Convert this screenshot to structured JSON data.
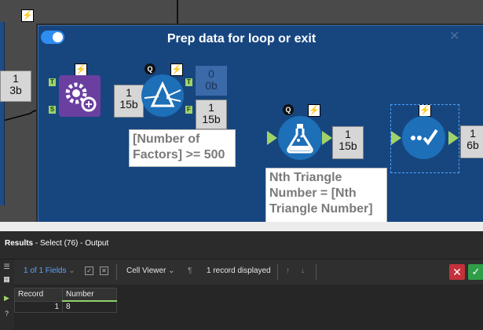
{
  "canvas": {
    "container_title": "Prep data for loop or exit",
    "colors": {
      "container_bg": "#17467f",
      "anchor": "#9fd36a",
      "toggle": "#2e8df0",
      "formula_tool": "#1d6fb8",
      "multi_row_tool": "#6b3fa0"
    },
    "badges": {
      "bolt": "⚡",
      "query": "Q"
    },
    "counts": {
      "left_in": {
        "records": "1",
        "size": "3b"
      },
      "multi_out": {
        "records": "1",
        "size": "15b"
      },
      "filter_true": {
        "records": "0",
        "size": "0b"
      },
      "filter_false": {
        "records": "1",
        "size": "15b"
      },
      "formula_out": {
        "records": "1",
        "size": "15b"
      },
      "select_out": {
        "records": "1",
        "size": "6b"
      }
    },
    "anchors": {
      "target": "T",
      "source": "S",
      "true": "T",
      "false": "F"
    },
    "annotations": {
      "filter": "[Number of Factors] >= 500",
      "formula": "Nth Triangle Number = [Nth Triangle Number]"
    },
    "icons": {
      "multi_row": "gears-plus-icon",
      "filter": "prism-filter-icon",
      "formula": "flask-icon",
      "select": "checkmark-select-icon"
    }
  },
  "results": {
    "title_bold": "Results",
    "title_rest": " - Select (76) - Output",
    "toolbar": {
      "fields": "1 of 1 Fields",
      "viewer": "Cell Viewer",
      "record_count": "1 record displayed"
    },
    "grid": {
      "columns": [
        "Record",
        "Number"
      ],
      "rows": [
        {
          "record": "1",
          "number": "8"
        }
      ]
    },
    "colors": {
      "cancel": "#c3323a",
      "apply": "#2f9e48"
    }
  }
}
